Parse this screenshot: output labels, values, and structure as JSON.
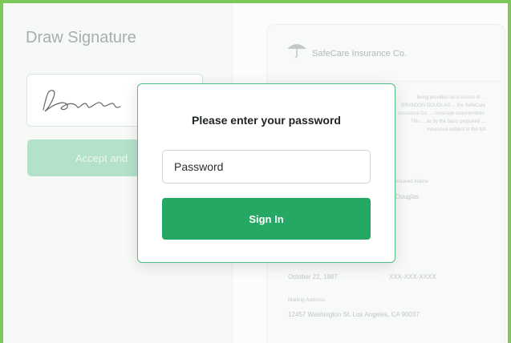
{
  "signature_panel": {
    "title": "Draw Signature",
    "accept_label": "Accept and"
  },
  "document": {
    "company": "SafeCare Insurance Co.",
    "paragraph": "being provided as a source of ... BRANDON DOUGLAS ... the SafeCare Insurance Co. ... coverage requirements. This ... as by the basic proposed ... insurance subject to the full",
    "name_label": "Insured Name",
    "name_value": "Douglas",
    "dob_value": "October 22, 1987",
    "ssn_value": "XXX-XXX-XXXX",
    "address_label": "Mailing Address",
    "address_value": "12457 Washington St. Los Angeles, CA 90037"
  },
  "modal": {
    "title": "Please enter your password",
    "password_placeholder": "Password",
    "signin_label": "Sign In"
  },
  "colors": {
    "frame_border": "#7cc95a",
    "accent": "#26a865",
    "modal_border": "#4fbf8a"
  }
}
